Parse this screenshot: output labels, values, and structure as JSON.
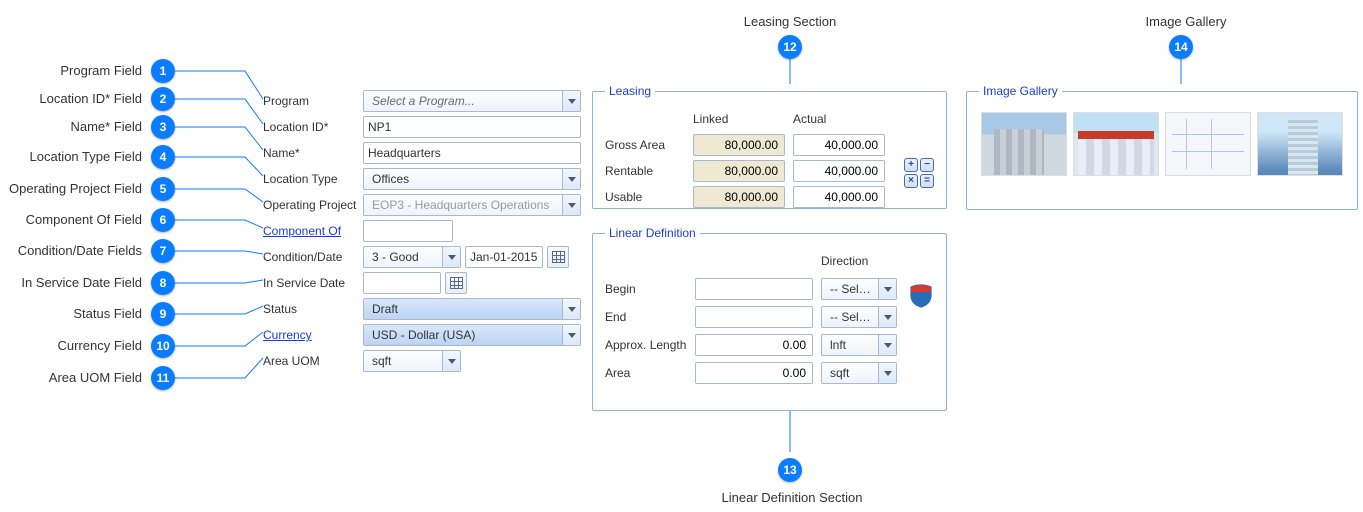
{
  "callouts": {
    "c1": "Program Field",
    "c2": "Location ID* Field",
    "c3": "Name* Field",
    "c4": "Location Type Field",
    "c5": "Operating Project Field",
    "c6": "Component Of Field",
    "c7": "Condition/Date Fields",
    "c8": "In Service Date Field",
    "c9": "Status Field",
    "c10": "Currency Field",
    "c11": "Area UOM Field",
    "c12": "Leasing Section",
    "c13": "Linear Definition Section",
    "c14": "Image Gallery"
  },
  "badges": {
    "b1": "1",
    "b2": "2",
    "b3": "3",
    "b4": "4",
    "b5": "5",
    "b6": "6",
    "b7": "7",
    "b8": "8",
    "b9": "9",
    "b10": "10",
    "b11": "11",
    "b12": "12",
    "b13": "13",
    "b14": "14"
  },
  "form": {
    "program": {
      "label": "Program",
      "placeholder": "Select a Program..."
    },
    "location_id": {
      "label": "Location ID*",
      "value": "NP1"
    },
    "name": {
      "label": "Name*",
      "value": "Headquarters"
    },
    "location_type": {
      "label": "Location Type",
      "value": "Offices"
    },
    "operating_proj": {
      "label": "Operating Project",
      "value": "EOP3 - Headquarters Operations"
    },
    "component_of": {
      "label": "Component Of",
      "value": ""
    },
    "condition": {
      "label": "Condition/Date",
      "value": "3 - Good",
      "date": "Jan-01-2015"
    },
    "in_service": {
      "label": "In Service Date",
      "value": ""
    },
    "status": {
      "label": "Status",
      "value": "Draft"
    },
    "currency": {
      "label": "Currency",
      "value": "USD - Dollar (USA)"
    },
    "area_uom": {
      "label": "Area UOM",
      "value": "sqft"
    }
  },
  "leasing": {
    "legend": "Leasing",
    "hdr_linked": "Linked",
    "hdr_actual": "Actual",
    "rows": {
      "gross": {
        "label": "Gross Area",
        "linked": "80,000.00",
        "actual": "40,000.00"
      },
      "rentable": {
        "label": "Rentable",
        "linked": "80,000.00",
        "actual": "40,000.00"
      },
      "usable": {
        "label": "Usable",
        "linked": "80,000.00",
        "actual": "40,000.00"
      }
    },
    "calc": {
      "plus": "+",
      "minus": "−",
      "mult": "×",
      "eq": "="
    }
  },
  "linear": {
    "legend": "Linear Definition",
    "hdr_direction": "Direction",
    "begin": {
      "label": "Begin",
      "value": "",
      "dir": "-- Select -"
    },
    "end": {
      "label": "End",
      "value": "",
      "dir": "-- Select -"
    },
    "length": {
      "label": "Approx. Length",
      "value": "0.00",
      "unit": "lnft"
    },
    "area": {
      "label": "Area",
      "value": "0.00",
      "unit": "sqft"
    }
  },
  "gallery": {
    "legend": "Image Gallery"
  }
}
